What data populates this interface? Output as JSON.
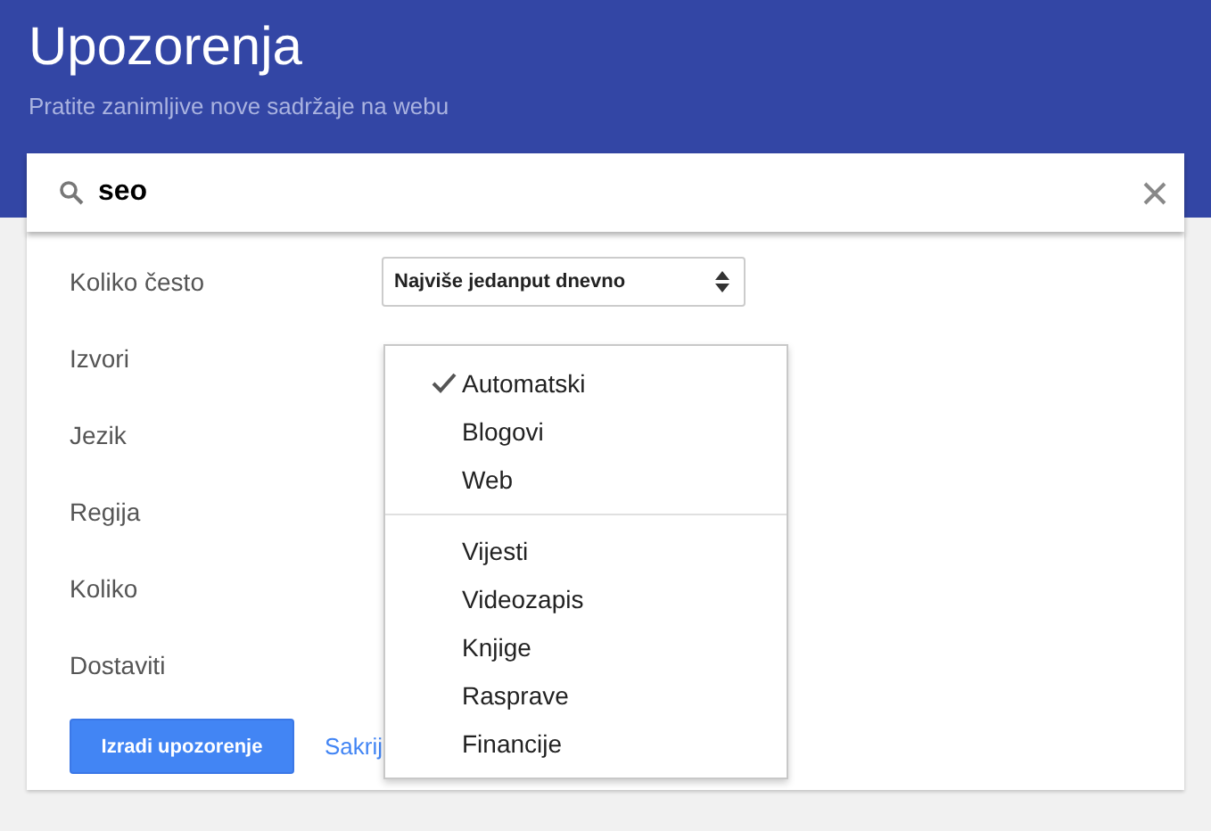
{
  "header": {
    "title": "Upozorenja",
    "subtitle": "Pratite zanimljive nove sadržaje na webu"
  },
  "search": {
    "value": "seo"
  },
  "settings": [
    {
      "label": "Koliko često",
      "kind": "select",
      "value": "Najviše jedanput dnevno"
    },
    {
      "label": "Izvori",
      "kind": "open"
    },
    {
      "label": "Jezik",
      "kind": "plain"
    },
    {
      "label": "Regija",
      "kind": "plain"
    },
    {
      "label": "Koliko",
      "kind": "plain"
    },
    {
      "label": "Dostaviti",
      "kind": "plain"
    }
  ],
  "create_button": "Izradi upozorenje",
  "hide_link": "Sakrij",
  "dropdown": {
    "groups": [
      [
        {
          "label": "Automatski",
          "selected": true
        },
        {
          "label": "Blogovi",
          "selected": false
        },
        {
          "label": "Web",
          "selected": false
        }
      ],
      [
        {
          "label": "Vijesti",
          "selected": false
        },
        {
          "label": "Videozapis",
          "selected": false
        },
        {
          "label": "Knjige",
          "selected": false
        },
        {
          "label": "Rasprave",
          "selected": false
        },
        {
          "label": "Financije",
          "selected": false
        }
      ]
    ]
  }
}
